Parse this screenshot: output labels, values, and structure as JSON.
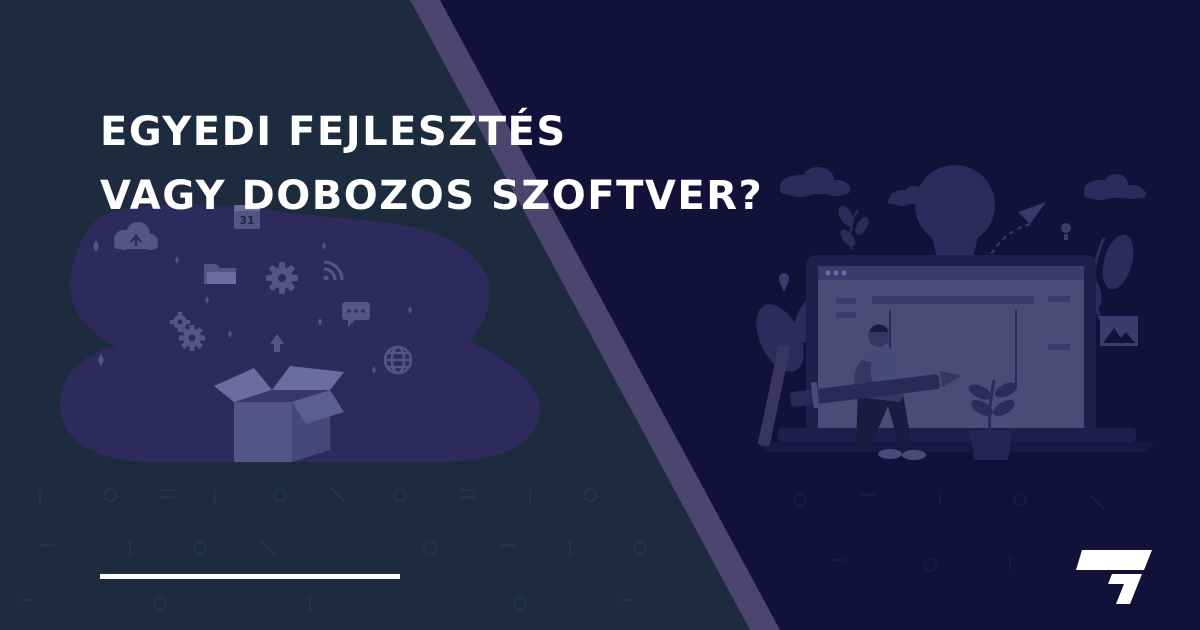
{
  "headline": {
    "line1": "EGYEDI FEJLESZTÉS",
    "line2": "VAGY DOBOZOS SZOFTVER?"
  },
  "illustrations": {
    "left": {
      "calendar_day": "31",
      "icons": [
        "cloud-upload-icon",
        "calendar-icon",
        "folder-icon",
        "gear-icon",
        "wifi-icon",
        "chat-icon",
        "arrow-up-icon",
        "globe-icon",
        "box-icon"
      ]
    },
    "right": {
      "icons": [
        "lightbulb-icon",
        "laptop-icon",
        "person-icon",
        "pencil-icon",
        "plant-icon",
        "paper-plane-icon",
        "cloud-icon",
        "leaf-icon",
        "image-icon"
      ]
    }
  },
  "logo": {
    "icon": "brand-logo-icon"
  },
  "colors": {
    "left_panel": "#1c2b3d",
    "right_panel": "#13113a",
    "divider": "#4b4570",
    "blob": "#2e2b5c",
    "icon": "#555487",
    "text": "#ffffff"
  }
}
